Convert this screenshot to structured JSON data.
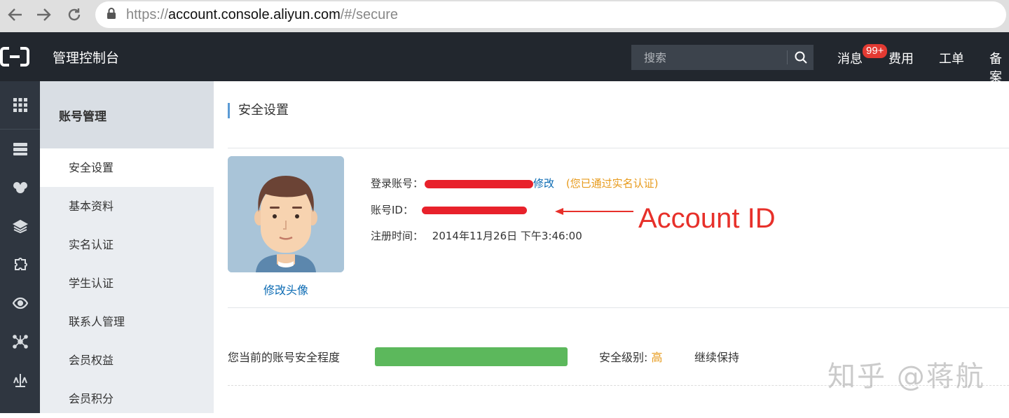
{
  "browser": {
    "url_scheme": "https://",
    "url_host": "account.console.aliyun.com",
    "url_path": "/#/secure",
    "icons": [
      "back-icon",
      "forward-icon",
      "reload-icon",
      "lock-icon"
    ]
  },
  "topbar": {
    "title": "管理控制台",
    "search_placeholder": "搜索",
    "nav": {
      "messages": "消息",
      "messages_badge": "99+",
      "billing": "费用",
      "tickets": "工单",
      "beian": "备案"
    },
    "colors": {
      "background": "#22272e",
      "badge": "#e33a32"
    }
  },
  "rail": {
    "icons": [
      "apps-grid-icon",
      "server-icon",
      "brain-icon",
      "layers-icon",
      "puzzle-icon",
      "eye-icon",
      "network-icon",
      "balance-icon"
    ]
  },
  "sidebar": {
    "heading": "账号管理",
    "items": [
      {
        "label": "安全设置",
        "active": true
      },
      {
        "label": "基本资料",
        "active": false
      },
      {
        "label": "实名认证",
        "active": false
      },
      {
        "label": "学生认证",
        "active": false
      },
      {
        "label": "联系人管理",
        "active": false
      },
      {
        "label": "会员权益",
        "active": false
      },
      {
        "label": "会员积分",
        "active": false
      }
    ]
  },
  "main": {
    "title": "安全设置",
    "avatar_link": "修改头像",
    "login_account_label": "登录账号：",
    "modify_link": "修改",
    "verified_note": "(您已通过实名认证)",
    "account_id_label": "账号ID：",
    "register_label": "注册时间：",
    "register_value": "2014年11月26日 下午3:46:00",
    "annotation": "Account ID",
    "security_label": "您当前的账号安全程度",
    "security_progress": 1.0,
    "security_level_label": "安全级别:",
    "security_level_value": "高",
    "security_keep": "继续保持",
    "colors": {
      "link": "#0a6ab3",
      "orange": "#e79a1b",
      "progress": "#5cb85c",
      "annotation": "#e7302a"
    }
  },
  "watermark": "知乎 @蒋航"
}
